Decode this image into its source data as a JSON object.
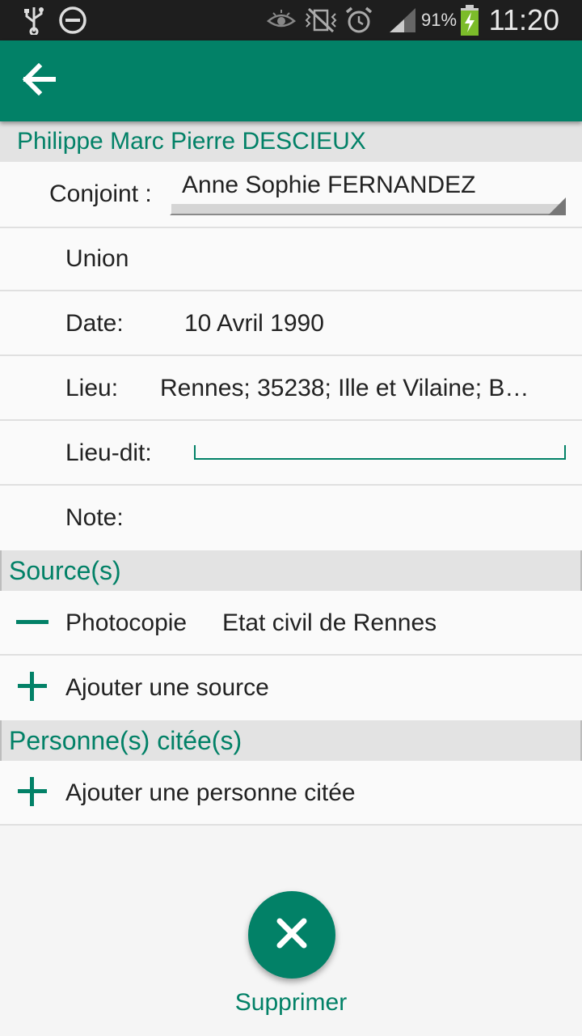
{
  "status_bar": {
    "battery_percent": "91%",
    "time": "11:20",
    "icons": [
      "usb-icon",
      "do-not-disturb-icon",
      "eye-icon",
      "vibrate-off-icon",
      "alarm-icon",
      "signal-icon",
      "battery-charging-icon"
    ]
  },
  "app_bar": {
    "back_icon": "arrow-back-icon"
  },
  "person": {
    "name": "Philippe Marc Pierre DESCIEUX"
  },
  "form": {
    "spouse_label": "Conjoint :",
    "spouse_value": "Anne Sophie FERNANDEZ",
    "union_label": "Union",
    "date_label": "Date:",
    "date_value": "10 Avril 1990",
    "place_label": "Lieu:",
    "place_value": "Rennes;  35238;  Ille et Vilaine;  B…",
    "lieudit_label": "Lieu-dit:",
    "lieudit_value": "",
    "note_label": "Note:"
  },
  "sources": {
    "title": "Source(s)",
    "items": [
      {
        "type": "Photocopie",
        "name": "Etat civil de Rennes"
      }
    ],
    "add_label": "Ajouter une source"
  },
  "persons_cited": {
    "title": "Personne(s) citée(s)",
    "add_label": "Ajouter une personne citée"
  },
  "delete": {
    "label": "Supprimer"
  },
  "colors": {
    "accent": "#028167",
    "status_bar": "#1e1e1e",
    "section_bg": "#e3e3e3"
  }
}
